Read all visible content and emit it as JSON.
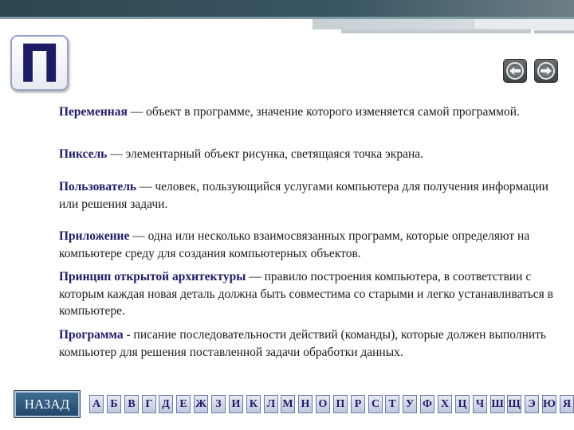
{
  "tile": {
    "letter": "П"
  },
  "nav": {
    "prev_icon": "arrow-left-icon",
    "next_icon": "arrow-right-icon"
  },
  "entries": [
    {
      "term": "Переменная",
      "definition": " — объект в программе, значение которого изменяется самой программой."
    },
    {
      "term": "Пиксель",
      "definition": " — элементарный объект рисунка, светящаяся точка экрана."
    },
    {
      "term": "Пользователь",
      "definition": " — человек, пользующийся услугами компьютера для получения информации или решения задачи."
    },
    {
      "term": "Приложение",
      "definition": " — одна или несколько взаимосвязанных программ, которые определяют на компьютере среду для создания компьютерных объектов."
    },
    {
      "term": "Принцип открытой архитектуры",
      "definition": " — правило построения компьютера, в соответствии с которым каждая новая деталь должна быть совместима со старыми и легко устанавливаться в компьютере."
    },
    {
      "term": "Программа",
      "definition": " - писание последовательности действий (команды), которые должен выполнить компьютер для решения поставленной задачи обработки данных."
    }
  ],
  "back_button": {
    "label": "НАЗАД"
  },
  "alphabet": [
    "А",
    "Б",
    "В",
    "Г",
    "Д",
    "Е",
    "Ж",
    "З",
    "И",
    "К",
    "Л",
    "М",
    "Н",
    "О",
    "П",
    "Р",
    "С",
    "Т",
    "У",
    "Ф",
    "Х",
    "Ц",
    "Ч",
    "Ш",
    "Щ",
    "Э",
    "Ю",
    "Я"
  ]
}
